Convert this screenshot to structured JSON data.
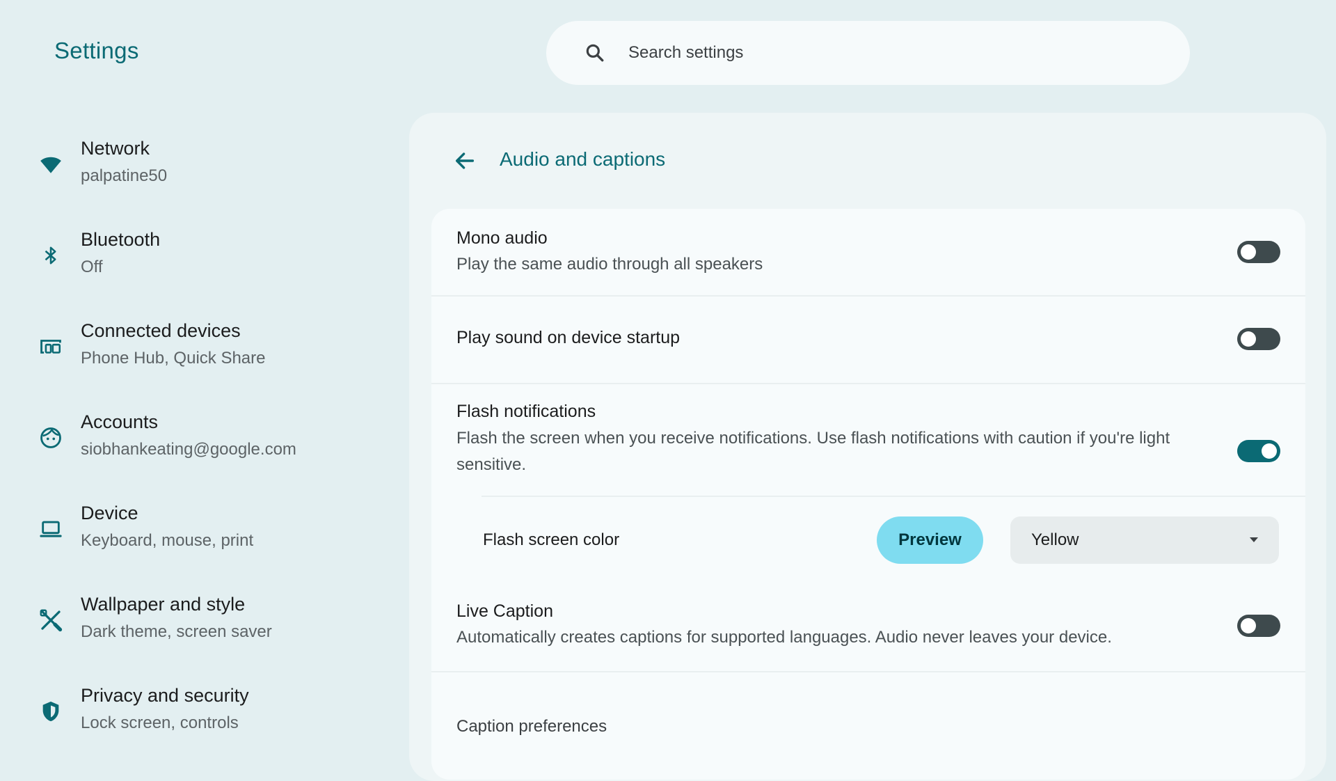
{
  "app": {
    "title": "Settings"
  },
  "search": {
    "placeholder": "Search settings",
    "icon": "search-icon"
  },
  "sidebar": {
    "items": [
      {
        "label": "Network",
        "sub": "palpatine50",
        "icon": "wifi-icon"
      },
      {
        "label": "Bluetooth",
        "sub": "Off",
        "icon": "bluetooth-icon"
      },
      {
        "label": "Connected devices",
        "sub": "Phone Hub, Quick Share",
        "icon": "connected-devices-icon"
      },
      {
        "label": "Accounts",
        "sub": "siobhankeating@google.com",
        "icon": "account-face-icon"
      },
      {
        "label": "Device",
        "sub": "Keyboard, mouse, print",
        "icon": "laptop-icon"
      },
      {
        "label": "Wallpaper and style",
        "sub": "Dark theme, screen saver",
        "icon": "paint-brush-icon"
      },
      {
        "label": "Privacy and security",
        "sub": "Lock screen, controls",
        "icon": "shield-icon"
      }
    ]
  },
  "page": {
    "title": "Audio and captions",
    "back_icon": "arrow-back-icon"
  },
  "settings": {
    "mono_audio": {
      "title": "Mono audio",
      "sub": "Play the same audio through all speakers",
      "enabled": false
    },
    "startup_sound": {
      "title": "Play sound on device startup",
      "enabled": false
    },
    "flash_notifications": {
      "title": "Flash notifications",
      "sub": "Flash the screen when you receive notifications. Use flash notifications with caution if you're light sensitive.",
      "enabled": true
    },
    "flash_color": {
      "label": "Flash screen color",
      "preview_label": "Preview",
      "selected": "Yellow"
    },
    "live_caption": {
      "title": "Live Caption",
      "sub": "Automatically creates captions for supported languages. Audio never leaves your device.",
      "enabled": false
    },
    "caption_preferences": {
      "label": "Caption preferences"
    }
  },
  "colors": {
    "accent": "#0b6a74",
    "background": "#e3eff1",
    "toggle_off": "#3e4a4d",
    "preview_button": "#7fdcf0"
  }
}
